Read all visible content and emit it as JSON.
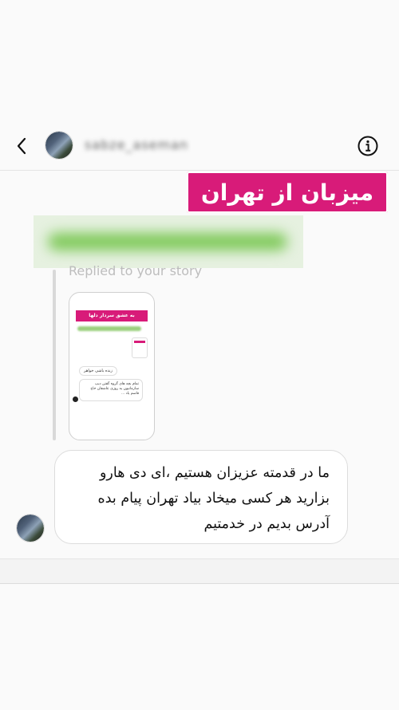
{
  "header": {
    "username": "sabze_aseman",
    "back_icon": "chevron-left-icon",
    "info_icon": "info-circle-icon"
  },
  "banner": {
    "text": "میزبان از تهران"
  },
  "reply": {
    "label": "Replied to your story"
  },
  "story": {
    "title": "به عشق سردار دلها",
    "bubble1": "زنده باشی خواهر",
    "bubble2": "تمام بچه های گروه گفتن دیپ سازمانیون یه روزی عاشقان حاج قاسم یاد ..."
  },
  "message": {
    "text": "ما در قدمته عزیزان هستیم ،ای دی هارو بزارید هر کسی میخاد بیاد تهران پیام بده آدرس بدیم در خدمتیم"
  },
  "colors": {
    "accent": "#d81b79",
    "blur_green": "#7fc95a"
  }
}
